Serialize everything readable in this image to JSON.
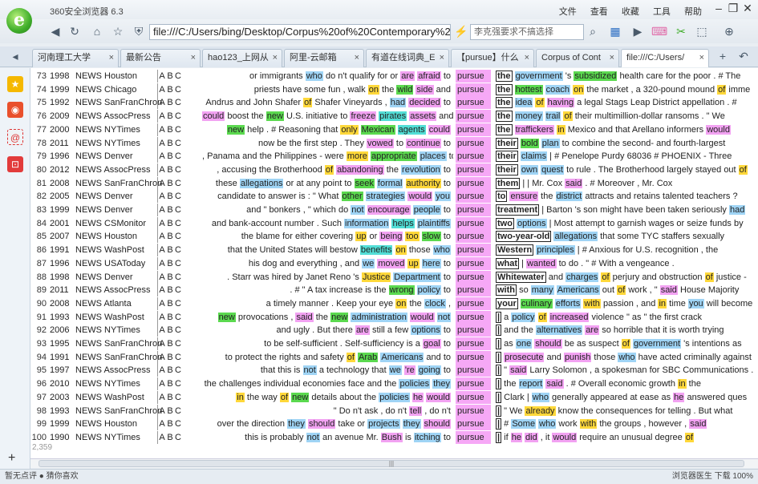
{
  "browser": {
    "title": "360安全浏览器 6.3",
    "menu": [
      "文件",
      "查看",
      "收藏",
      "工具",
      "帮助"
    ],
    "address": "file:///C:/Users/bing/Desktop/Corpus%20of%20Contemporary%20",
    "search_placeholder": "李克强要求不搞选择",
    "tabs": [
      "河南理工大学",
      "最新公告",
      "hao123_上网从",
      "阿里-云邮箱",
      "有道在线词典_E",
      "【pursue】什么",
      "Corpus of Cont",
      "file:///C:/Users/"
    ]
  },
  "rows": [
    {
      "n": "73",
      "year": "1998",
      "src": "NEWS Houston",
      "left": "or immigrants who do n't qualify for or are afraid to",
      "right": "the government 's subsidized health care for the poor . # The"
    },
    {
      "n": "74",
      "year": "1999",
      "src": "NEWS Chicago",
      "left": "priests have some fun , walk on the wild side and",
      "right": "the hottest coach on the market , a 320-pound mound of imme"
    },
    {
      "n": "75",
      "year": "1992",
      "src": "NEWS SanFranChron",
      "left": "Andrus and John Shafer of Shafer Vineyards , had decided to",
      "right": "the idea of having a legal Stags Leap District appellation . #"
    },
    {
      "n": "76",
      "year": "2009",
      "src": "NEWS AssocPress",
      "left": "could boost the new U.S. initiative to freeze pirates assets and",
      "right": "the money trail of their multimillion-dollar ransoms . \" We"
    },
    {
      "n": "77",
      "year": "2000",
      "src": "NEWS NYTimes",
      "left": "new help . # Reasoning that only Mexican agents could",
      "right": "the traffickers in Mexico and that Arellano informers would"
    },
    {
      "n": "78",
      "year": "2011",
      "src": "NEWS NYTimes",
      "left": "now be the first step . They vowed to continue to",
      "right": "their bold plan to combine the second- and fourth-largest"
    },
    {
      "n": "79",
      "year": "1996",
      "src": "NEWS Denver",
      "left": ", Panama and the Philippines - were more appropriate places to",
      "right": "their claims | # Penelope Purdy 68036 # PHOENIX - Three"
    },
    {
      "n": "80",
      "year": "2012",
      "src": "NEWS AssocPress",
      "left": ", accusing the Brotherhood of abandoning the revolution to",
      "right": "their own quest to rule . The Brotherhood largely stayed out of"
    },
    {
      "n": "81",
      "year": "2008",
      "src": "NEWS SanFranChron",
      "left": "these allegations or at any point to seek formal authority to",
      "right": "them | | Mr. Cox said . # Moreover , Mr. Cox"
    },
    {
      "n": "82",
      "year": "2005",
      "src": "NEWS Denver",
      "left": "candidate to answer is : \" What other strategies would you",
      "right": "to ensure the district attracts and retains talented teachers ?"
    },
    {
      "n": "83",
      "year": "1999",
      "src": "NEWS Denver",
      "left": "and \" bonkers , \" which do not encourage people to",
      "right": "treatment | Barton 's son might have been taken seriously had"
    },
    {
      "n": "84",
      "year": "2001",
      "src": "NEWS CSMonitor",
      "left": "and bank-account number . Such information helps plaintiffs",
      "right": "two options | Most attempt to garnish wages or seize funds by"
    },
    {
      "n": "85",
      "year": "2007",
      "src": "NEWS Houston",
      "left": "the blame for either covering up or being too slow to",
      "right": "two-year-old allegations that some TYC staffers sexually"
    },
    {
      "n": "86",
      "year": "1991",
      "src": "NEWS WashPost",
      "left": "that the United States will bestow benefits on those who",
      "right": "Western principles | # Anxious for U.S. recognition , the"
    },
    {
      "n": "87",
      "year": "1996",
      "src": "NEWS USAToday",
      "left": "his dog and everything , and we moved up here to",
      "right": "what | wanted to do . \" # With a vengeance ."
    },
    {
      "n": "88",
      "year": "1998",
      "src": "NEWS Denver",
      "left": ". Starr was hired by Janet Reno 's Justice Department to",
      "right": "Whitewater and charges of perjury and obstruction of justice -"
    },
    {
      "n": "89",
      "year": "2011",
      "src": "NEWS AssocPress",
      "left": ". # \" A tax increase is the wrong policy to",
      "right": "with so many Americans out of work , \" said House Majority"
    },
    {
      "n": "90",
      "year": "2008",
      "src": "NEWS Atlanta",
      "left": "a timely manner . Keep your eye on the clock ,",
      "right": "your culinary efforts with passion , and in time you will become"
    },
    {
      "n": "91",
      "year": "1993",
      "src": "NEWS WashPost",
      "left": "new provocations , said the new administration would not",
      "right": "| a policy of increased violence \" as \" the first crack"
    },
    {
      "n": "92",
      "year": "2006",
      "src": "NEWS NYTimes",
      "left": "and ugly . But there are still a few options to",
      "right": "| and the alternatives are so horrible that it is worth trying"
    },
    {
      "n": "93",
      "year": "1995",
      "src": "NEWS SanFranChron",
      "left": "to be self-sufficient . Self-sufficiency is a goal to",
      "right": "| as one should be as suspect of government 's intentions as"
    },
    {
      "n": "94",
      "year": "1991",
      "src": "NEWS SanFranChron",
      "left": "to protect the rights and safety of Arab Americans and to",
      "right": "| prosecute and punish those who have acted criminally against"
    },
    {
      "n": "95",
      "year": "1997",
      "src": "NEWS AssocPress",
      "left": "that this is not a technology that we 're going to",
      "right": "| \" said Larry Solomon , a spokesman for SBC Communications ."
    },
    {
      "n": "96",
      "year": "2010",
      "src": "NEWS NYTimes",
      "left": "the challenges individual economies face and the policies they",
      "right": "| the report said . # Overall economic growth in the"
    },
    {
      "n": "97",
      "year": "2003",
      "src": "NEWS WashPost",
      "left": "in the way of new details about the policies he would",
      "right": "| Clark | who generally appeared at ease as he answered ques"
    },
    {
      "n": "98",
      "year": "1993",
      "src": "NEWS SanFranChron",
      "left": "\" Do n't ask , do n't tell , do n't",
      "right": "| \" We already know the consequences for telling . But what"
    },
    {
      "n": "99",
      "year": "1999",
      "src": "NEWS Houston",
      "left": "over the direction they should take or projects they should",
      "right": "| # Some who work with the groups , however , said"
    },
    {
      "n": "100",
      "year": "1990",
      "src": "NEWS NYTimes",
      "left": "this is probably not an avenue Mr. Bush is itching to",
      "right": "| if he did , it would require an unusual degree of"
    }
  ],
  "kwic": "pursue",
  "abc": [
    "A",
    "B",
    "C"
  ],
  "more_count": "2,359",
  "status": {
    "left": "暂无点评  ● 猜你喜欢",
    "right": "浏览器医生  下载  100%"
  }
}
